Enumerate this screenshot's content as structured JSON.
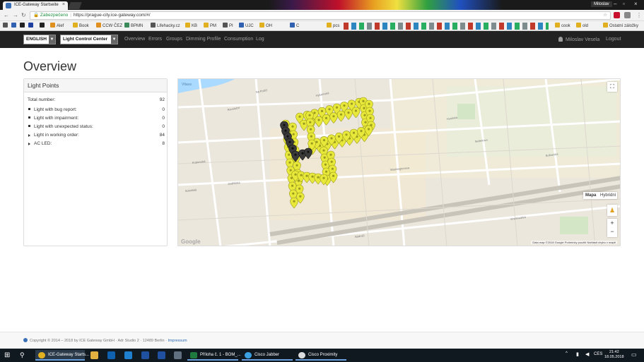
{
  "browser": {
    "tab_title": "ICE-Gateway Startseite",
    "user": "Miloslav",
    "secure_label": "Zabezpečeno",
    "url": "https://prague-city.ice-gateway.com/#/",
    "bookmarks": [
      {
        "label": "Alef",
        "color": "#e09020"
      },
      {
        "label": "Book",
        "color": "#e0b020"
      },
      {
        "label": "CCW ČEZ",
        "color": "#e09020"
      },
      {
        "label": "BPMN",
        "color": "#3a8a5a"
      },
      {
        "label": "Lifehacky.cz",
        "color": "#555555"
      },
      {
        "label": "KB",
        "color": "#e0b020"
      },
      {
        "label": "PM",
        "color": "#e0b020"
      },
      {
        "label": "PI",
        "color": "#555555"
      },
      {
        "label": "UJC",
        "color": "#3060b0"
      },
      {
        "label": "OH",
        "color": "#e0b020"
      },
      {
        "label": "C",
        "color": "#3060b0"
      },
      {
        "label": "pcs",
        "color": "#e0b020"
      },
      {
        "label": "cook",
        "color": "#e0b020"
      },
      {
        "label": "old",
        "color": "#e0b020"
      }
    ],
    "other_bookmarks": "Ostatní záložky"
  },
  "app": {
    "language": "ENGLISH",
    "module": "Light Control Center",
    "nav": [
      "Overview",
      "Errors",
      "Groups",
      "Dimming Profile",
      "Consumption",
      "Log"
    ],
    "user_name": "Miloslav Vesela",
    "logout": "Logout"
  },
  "page": {
    "title": "Overview",
    "panel_title": "Light Points",
    "total_label": "Total number:",
    "total_value": "92",
    "stats": [
      {
        "label": "Light with bug report:",
        "value": "0",
        "marker": "bullet"
      },
      {
        "label": "Light with impairment:",
        "value": "0",
        "marker": "bullet"
      },
      {
        "label": "Light with unexpected status:",
        "value": "0",
        "marker": "bullet"
      },
      {
        "label": "Light in working order:",
        "value": "84",
        "marker": "triangle"
      },
      {
        "label": "AC LED:",
        "value": "8",
        "marker": "triangle"
      }
    ]
  },
  "map": {
    "river_label": "Vltava",
    "type_map": "Mapa",
    "type_hybrid": "Hybridní",
    "google": "Google",
    "attribution": "Data map ©2018 Google   Podmínky použití   Nahlásit chybu v mapě",
    "zoom_in": "+",
    "zoom_out": "−",
    "fullscreen": "⛶",
    "streets": [
      "Revoluční",
      "Na Poříčí",
      "Havlíčkova",
      "Hybernská",
      "Politických vězňů",
      "Washingtonova",
      "Krakovská",
      "Sokolská",
      "Bělehradská",
      "Konviktská",
      "Nádraží",
      "Vinohradská",
      "Italská",
      "Seifertova",
      "Husitská",
      "Bulharská",
      "Myslíkova",
      "Jindřišská",
      "Opletalova"
    ],
    "colors": {
      "working": "#e8e83a",
      "ac_led": "#3a3a3a"
    }
  },
  "footer": {
    "text": "Copyright © 2014 – 2018 by ICE Gateway GmbH · Adr Studio 2 · 12489 Berlin ·",
    "link": "Impressum"
  },
  "taskbar": {
    "apps": [
      "ICE-Gateway Starts...",
      "Příloha č. 1 - BOM_...",
      "Cisco Jabber",
      "Cisco Proximity"
    ],
    "language": "CES",
    "time": "21:42",
    "date": "18.05.2018"
  }
}
